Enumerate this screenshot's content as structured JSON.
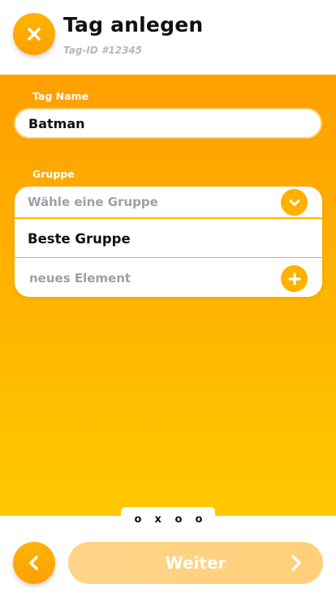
{
  "header": {
    "title": "Tag anlegen",
    "subtitle": "Tag-ID #12345",
    "close_icon": "close-icon"
  },
  "form": {
    "name_label": "Tag Name",
    "name_value": "Batman",
    "group_label": "Gruppe",
    "group_placeholder": "Wähle eine Gruppe",
    "group_options": [
      "Beste Gruppe"
    ],
    "new_element_label": "neues Element"
  },
  "pager": {
    "dots": [
      "o",
      "x",
      "o",
      "o"
    ]
  },
  "footer": {
    "back_icon": "chevron-left-icon",
    "next_label": "Weiter",
    "next_icon": "chevron-right-icon"
  },
  "colors": {
    "accent": "#ffa000",
    "accent_light": "#ffc800",
    "next_disabled": "#ffd48a",
    "muted_text": "#9ea0a8"
  }
}
